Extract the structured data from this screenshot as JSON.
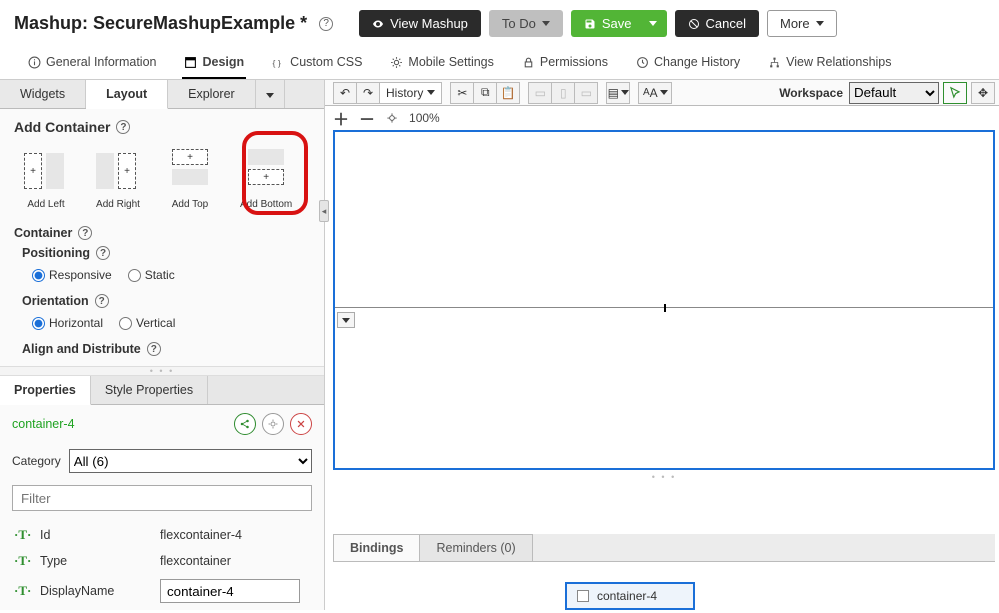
{
  "header": {
    "prefix": "Mashup:",
    "name": "SecureMashupExample *",
    "view": "View Mashup",
    "todo": "To Do",
    "save": "Save",
    "cancel": "Cancel",
    "more": "More"
  },
  "nav": {
    "general": "General Information",
    "design": "Design",
    "css": "Custom CSS",
    "mobile": "Mobile Settings",
    "permissions": "Permissions",
    "history": "Change History",
    "relationships": "View Relationships"
  },
  "panel_tabs": {
    "widgets": "Widgets",
    "layout": "Layout",
    "explorer": "Explorer"
  },
  "layout": {
    "add_container": "Add Container",
    "items": {
      "left": "Add Left",
      "right": "Add Right",
      "top": "Add Top",
      "bottom": "Add Bottom"
    },
    "container": "Container",
    "positioning": "Positioning",
    "responsive": "Responsive",
    "static": "Static",
    "orientation": "Orientation",
    "horizontal": "Horizontal",
    "vertical": "Vertical",
    "align": "Align and Distribute"
  },
  "props": {
    "tabs": {
      "properties": "Properties",
      "style": "Style Properties"
    },
    "selected": "container-4",
    "category_label": "Category",
    "category_value": "All (6)",
    "filter_placeholder": "Filter",
    "rows": {
      "id": {
        "label": "Id",
        "value": "flexcontainer-4"
      },
      "type": {
        "label": "Type",
        "value": "flexcontainer"
      },
      "display": {
        "label": "DisplayName",
        "value": "container-4"
      }
    }
  },
  "toolbar": {
    "history": "History",
    "workspace_label": "Workspace",
    "workspace_value": "Default",
    "zoom": "100%"
  },
  "bottom": {
    "bindings": "Bindings",
    "reminders": "Reminders (0)",
    "chip": "container-4"
  }
}
